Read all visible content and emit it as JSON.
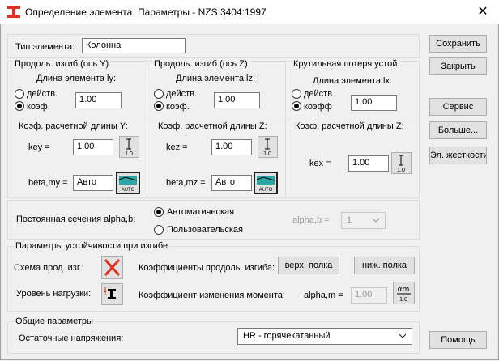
{
  "window": {
    "title": "Определение элемента. Параметры - NZS 3404:1997",
    "close_glyph": "✕"
  },
  "element_type": {
    "label": "Тип элемента:",
    "value": "Колонна"
  },
  "buckling_y": {
    "title": "Продоль. изгиб (ось Y)",
    "length_label": "Длина элемента ly:",
    "actual_label": "действ.",
    "coef_label": "коэф.",
    "selected": "coef",
    "value": "1.00",
    "k_title": "Коэф. расчетной длины Y:",
    "key_label": "key =",
    "key_value": "1.00",
    "beta_label": "beta,my =",
    "beta_value": "Авто"
  },
  "buckling_z": {
    "title": "Продоль. изгиб (ось Z)",
    "length_label": "Длина элемента lz:",
    "actual_label": "действ.",
    "coef_label": "коэф.",
    "selected": "coef",
    "value": "1.00",
    "k_title": "Коэф. расчетной длины Z:",
    "key_label": "kez =",
    "key_value": "1.00",
    "beta_label": "beta,mz =",
    "beta_value": "Авто"
  },
  "torsional": {
    "title": "Крутильная потеря устой.",
    "length_label": "Длина элемента lx:",
    "actual_label": "действ",
    "coef_label": "коэфф",
    "selected": "coef",
    "value": "1.00",
    "k_title": "Коэф. расчетной длины  Z:",
    "key_label": "kex =",
    "key_value": "1.00"
  },
  "alpha_b": {
    "label": "Постоянная сечения alpha,b:",
    "auto_label": "Автоматическая",
    "user_label": "Пользовательская",
    "selected": "auto",
    "field_label": "alpha,b =",
    "field_value": "1"
  },
  "stability": {
    "title": "Параметры устойчивости при изгибе",
    "scheme_label": "Схема прод. изг.:",
    "coef_label": "Коэффициенты продоль. изгиба:",
    "upper_button": "верх. полка",
    "lower_button": "ниж. полка",
    "load_label": "Уровень нагрузки:",
    "moment_label": "Коэффициент изменения момента:",
    "alpha_m_label": "alpha,m =",
    "alpha_m_value": "1.00"
  },
  "general": {
    "title": "Общие параметры",
    "residual_label": "Остаточные напряжения:",
    "residual_value": "HR - горячекатанный"
  },
  "buttons": {
    "save": "Сохранить",
    "close": "Закрыть",
    "service": "Сервис",
    "more": "Больше...",
    "stiffness": "Эл. жесткости",
    "help": "Помощь"
  },
  "icons": {
    "k_button_text": "1.0",
    "auto_text": "AUTO",
    "alpha_m_top": "αm",
    "alpha_m_bottom": "1.0",
    "accent_red": "#e03020",
    "accent_cyan": "#2aa6a6"
  }
}
